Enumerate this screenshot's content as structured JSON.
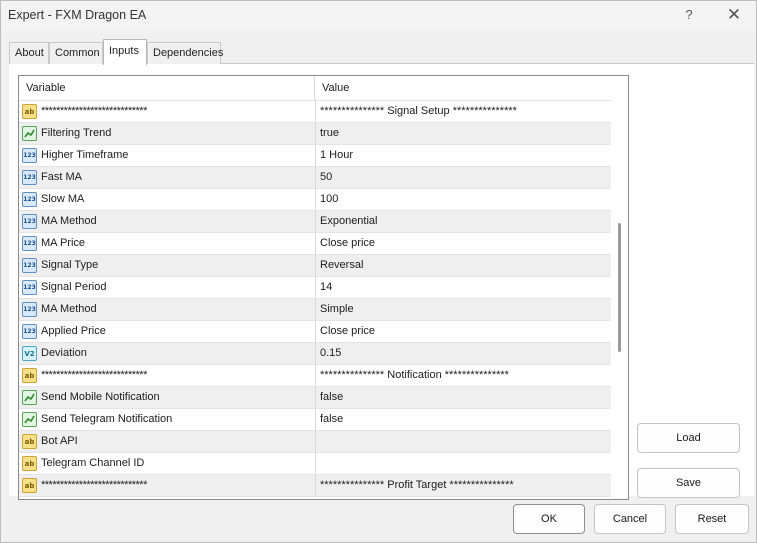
{
  "window": {
    "title": "Expert - FXM Dragon EA",
    "help_glyph": "?",
    "close_glyph": "✕"
  },
  "tabs": [
    {
      "label": "About"
    },
    {
      "label": "Common"
    },
    {
      "label": "Inputs"
    },
    {
      "label": "Dependencies"
    }
  ],
  "grid": {
    "headers": {
      "variable": "Variable",
      "value": "Value"
    },
    "rows": [
      {
        "icon": "string-icon",
        "glyph": "ab",
        "name": "****************************",
        "value": "*************** Signal Setup ***************"
      },
      {
        "icon": "bool-icon",
        "glyph": "",
        "name": "Filtering Trend",
        "value": "true"
      },
      {
        "icon": "integer-icon",
        "glyph": "123",
        "name": "Higher Timeframe",
        "value": "1 Hour"
      },
      {
        "icon": "integer-icon",
        "glyph": "123",
        "name": "Fast MA",
        "value": "50"
      },
      {
        "icon": "integer-icon",
        "glyph": "123",
        "name": "Slow MA",
        "value": "100"
      },
      {
        "icon": "integer-icon",
        "glyph": "123",
        "name": "MA Method",
        "value": "Exponential"
      },
      {
        "icon": "integer-icon",
        "glyph": "123",
        "name": "MA Price",
        "value": "Close price"
      },
      {
        "icon": "integer-icon",
        "glyph": "123",
        "name": "Signal Type",
        "value": "Reversal"
      },
      {
        "icon": "integer-icon",
        "glyph": "123",
        "name": "Signal Period",
        "value": "14"
      },
      {
        "icon": "integer-icon",
        "glyph": "123",
        "name": "MA Method",
        "value": "Simple"
      },
      {
        "icon": "integer-icon",
        "glyph": "123",
        "name": "Applied Price",
        "value": "Close price"
      },
      {
        "icon": "double-icon",
        "glyph": "V2",
        "name": "Deviation",
        "value": "0.15"
      },
      {
        "icon": "string-icon",
        "glyph": "ab",
        "name": "****************************",
        "value": "*************** Notification ***************"
      },
      {
        "icon": "bool-icon",
        "glyph": "",
        "name": "Send Mobile Notification",
        "value": "false"
      },
      {
        "icon": "bool-icon",
        "glyph": "",
        "name": "Send Telegram Notification",
        "value": "false"
      },
      {
        "icon": "string-icon",
        "glyph": "ab",
        "name": "Bot API",
        "value": ""
      },
      {
        "icon": "string-icon",
        "glyph": "ab",
        "name": "Telegram Channel ID",
        "value": ""
      },
      {
        "icon": "string-icon",
        "glyph": "ab",
        "name": "****************************",
        "value": "*************** Profit Target ***************"
      }
    ]
  },
  "buttons": {
    "load": "Load",
    "save": "Save",
    "ok": "OK",
    "cancel": "Cancel",
    "reset": "Reset"
  }
}
